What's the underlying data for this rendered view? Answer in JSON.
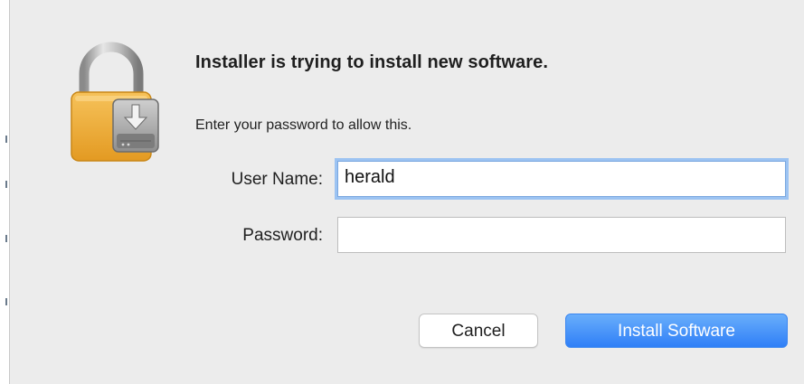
{
  "dialog": {
    "title": "Installer is trying to install new software.",
    "message": "Enter your password to allow this.",
    "icon": "lock-with-installer-icon"
  },
  "form": {
    "username_label": "User Name:",
    "username_value": "herald",
    "password_label": "Password:",
    "password_value": ""
  },
  "buttons": {
    "cancel_label": "Cancel",
    "install_label": "Install Software"
  },
  "colors": {
    "dialog_bg": "#ececec",
    "primary_button": "#3c8ef8",
    "focus_ring": "#9cc3f2",
    "lock_gold": "#f0b341"
  }
}
